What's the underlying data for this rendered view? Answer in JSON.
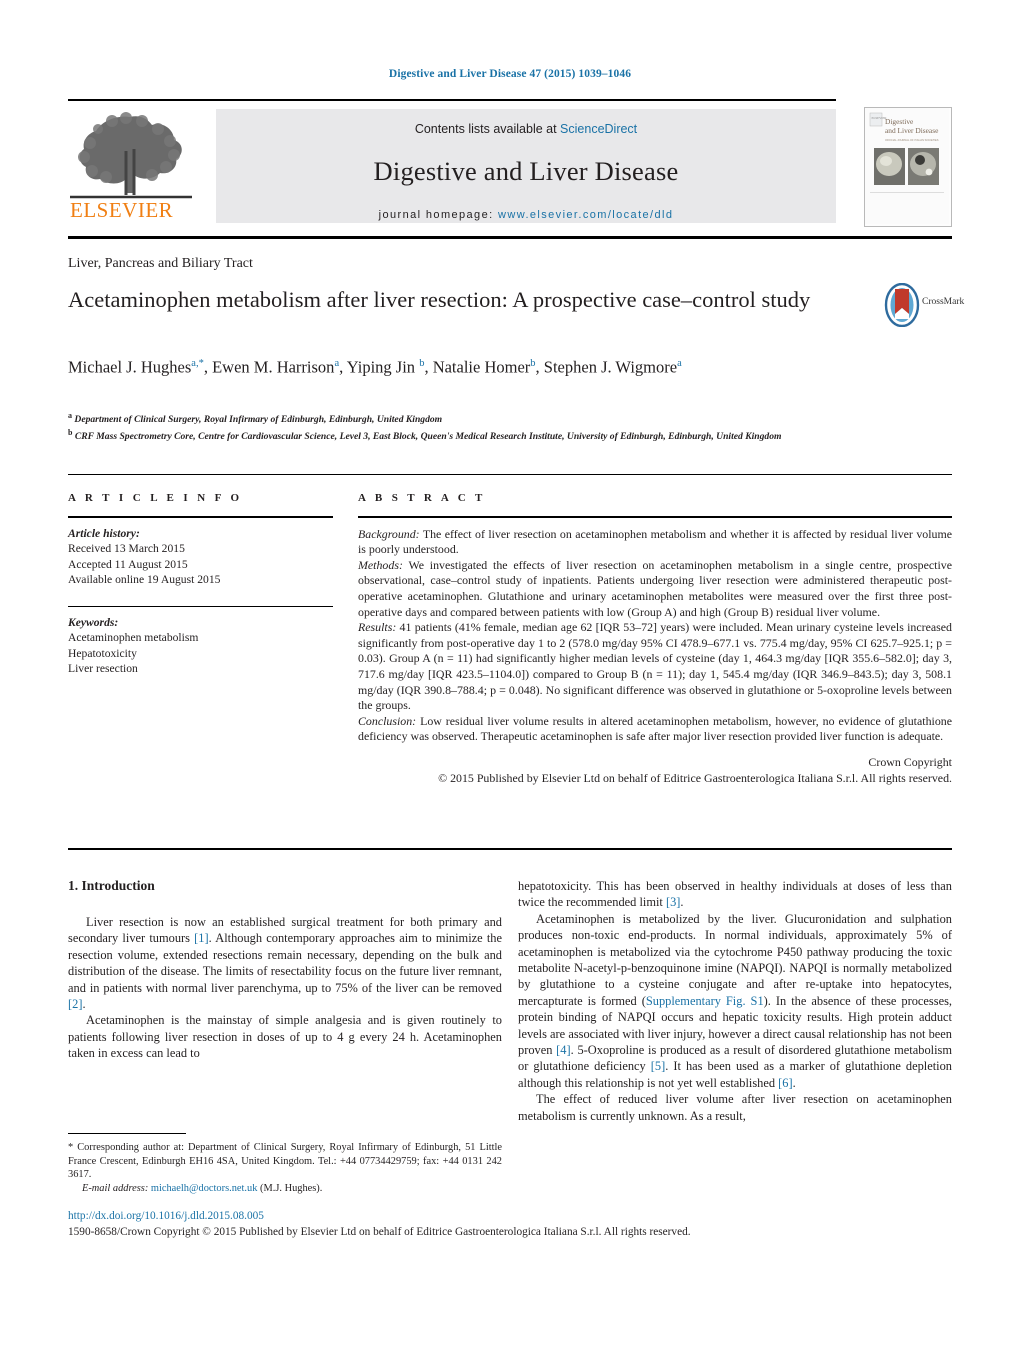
{
  "running_head": "Digestive and Liver Disease 47 (2015) 1039–1046",
  "masthead": {
    "contents_prefix": "Contents lists available at ",
    "contents_link": "ScienceDirect",
    "journal_title": "Digestive and Liver Disease",
    "homepage_prefix": "journal homepage:",
    "homepage_url": "www.elsevier.com/locate/dld",
    "publisher_wordmark": "ELSEVIER",
    "publisher_color": "#f07f13",
    "link_color": "#1a72a6",
    "cover_title_line1": "Digestive",
    "cover_title_line2": "and Liver Disease"
  },
  "article": {
    "section_kicker": "Liver, Pancreas and Biliary Tract",
    "title": "Acetaminophen metabolism after liver resection: A prospective case–control study",
    "crossmark_label": "CrossMark",
    "authors_html": "Michael J. Hughes<sup>a,<span>*</span></sup>, Ewen M. Harrison<sup>a</sup>, Yiping Jin <sup>b</sup>, Natalie Homer<sup>b</sup>, Stephen J. Wigmore<sup>a</sup>",
    "affiliations": [
      {
        "marker": "a",
        "text": "Department of Clinical Surgery, Royal Infirmary of Edinburgh, Edinburgh, United Kingdom"
      },
      {
        "marker": "b",
        "text": "CRF Mass Spectrometry Core, Centre for Cardiovascular Science, Level 3, East Block, Queen's Medical Research Institute, University of Edinburgh, Edinburgh, United Kingdom"
      }
    ]
  },
  "article_info": {
    "heading": "A R T I C L E   I N F O",
    "history_label": "Article history:",
    "history": [
      "Received 13 March 2015",
      "Accepted 11 August 2015",
      "Available online 19 August 2015"
    ],
    "keywords_label": "Keywords:",
    "keywords": [
      "Acetaminophen metabolism",
      "Hepatotoxicity",
      "Liver resection"
    ]
  },
  "abstract": {
    "heading": "A B S T R A C T",
    "sections": [
      {
        "label": "Background:",
        "text": " The effect of liver resection on acetaminophen metabolism and whether it is affected by residual liver volume is poorly understood."
      },
      {
        "label": "Methods:",
        "text": " We investigated the effects of liver resection on acetaminophen metabolism in a single centre, prospective observational, case–control study of inpatients. Patients undergoing liver resection were administered therapeutic post-operative acetaminophen. Glutathione and urinary acetaminophen metabolites were measured over the first three post-operative days and compared between patients with low (Group A) and high (Group B) residual liver volume."
      },
      {
        "label": "Results:",
        "text": " 41 patients (41% female, median age 62 [IQR 53–72] years) were included. Mean urinary cysteine levels increased significantly from post-operative day 1 to 2 (578.0 mg/day 95% CI 478.9–677.1 vs. 775.4 mg/day, 95% CI 625.7–925.1; p = 0.03). Group A (n = 11) had significantly higher median levels of cysteine (day 1, 464.3 mg/day [IQR 355.6–582.0]; day 3, 717.6 mg/day [IQR 423.5–1104.0]) compared to Group B (n = 11); day 1, 545.4 mg/day (IQR 346.9–843.5); day 3, 508.1 mg/day (IQR 390.8–788.4; p = 0.048). No significant difference was observed in glutathione or 5-oxoproline levels between the groups."
      },
      {
        "label": "Conclusion:",
        "text": " Low residual liver volume results in altered acetaminophen metabolism, however, no evidence of glutathione deficiency was observed. Therapeutic acetaminophen is safe after major liver resection provided liver function is adequate."
      }
    ],
    "copyright_line1": "Crown Copyright",
    "copyright_line2": "© 2015 Published by Elsevier Ltd on behalf of Editrice Gastroenterologica Italiana S.r.l. All rights reserved."
  },
  "body": {
    "intro_heading": "1.  Introduction",
    "left_paragraphs": [
      "Liver resection is now an established surgical treatment for both primary and secondary liver tumours [1]. Although contemporary approaches aim to minimize the resection volume, extended resections remain necessary, depending on the bulk and distribution of the disease. The limits of resectability focus on the future liver remnant, and in patients with normal liver parenchyma, up to 75% of the liver can be removed [2].",
      "Acetaminophen is the mainstay of simple analgesia and is given routinely to patients following liver resection in doses of up to 4 g every 24 h. Acetaminophen taken in excess can lead to"
    ],
    "right_paragraphs": [
      "hepatotoxicity. This has been observed in healthy individuals at doses of less than twice the recommended limit [3].",
      "Acetaminophen is metabolized by the liver. Glucuronidation and sulphation produces non-toxic end-products. In normal individuals, approximately 5% of acetaminophen is metabolized via the cytochrome P450 pathway producing the toxic metabolite N-acetyl-p-benzoquinone imine (NAPQI). NAPQI is normally metabolized by glutathione to a cysteine conjugate and after re-uptake into hepatocytes, mercapturate is formed (Supplementary Fig. S1). In the absence of these processes, protein binding of NAPQI occurs and hepatic toxicity results. High protein adduct levels are associated with liver injury, however a direct causal relationship has not been proven [4]. 5-Oxoproline is produced as a result of disordered glutathione metabolism or glutathione deficiency [5]. It has been used as a marker of glutathione depletion although this relationship is not yet well established [6].",
      "The effect of reduced liver volume after liver resection on acetaminophen metabolism is currently unknown. As a result,"
    ]
  },
  "footnote": {
    "corresponding_marker": "*",
    "corresponding_text": " Corresponding author at: Department of Clinical Surgery, Royal Infirmary of Edinburgh, 51 Little France Crescent, Edinburgh EH16 4SA, United Kingdom. Tel.: +44 07734429759; fax: +44 0131 242 3617.",
    "email_label": "E-mail address:",
    "email": "michaelh@doctors.net.uk",
    "email_owner": "(M.J. Hughes)."
  },
  "footer": {
    "doi_url": "http://dx.doi.org/10.1016/j.dld.2015.08.005",
    "copyright": "1590-8658/Crown Copyright © 2015 Published by Elsevier Ltd on behalf of Editrice Gastroenterologica Italiana S.r.l. All rights reserved."
  }
}
